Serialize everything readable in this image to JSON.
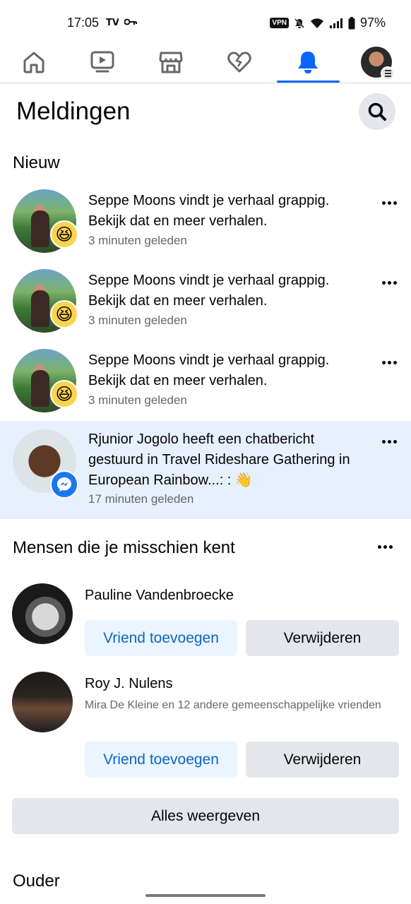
{
  "status_bar": {
    "time": "17:05",
    "vpn": "VPN",
    "battery": "97%"
  },
  "nav": {
    "items": [
      {
        "name": "home",
        "icon": "home-icon"
      },
      {
        "name": "video",
        "icon": "video-icon"
      },
      {
        "name": "marketplace",
        "icon": "store-icon"
      },
      {
        "name": "dating",
        "icon": "heart-icon"
      },
      {
        "name": "notifications",
        "icon": "bell-icon",
        "active": true
      },
      {
        "name": "menu",
        "icon": "profile-avatar"
      }
    ],
    "accent": "#0866ff"
  },
  "header": {
    "title": "Meldingen"
  },
  "sections": {
    "new": "Nieuw",
    "pymk": "Mensen die je misschien kent",
    "older": "Ouder"
  },
  "notifications": [
    {
      "actor": "Seppe Moons",
      "text_a": " vindt je verhaal grappig.",
      "text_b": "Bekijk dat en meer verhalen.",
      "time": "3 minuten geleden",
      "badge": "haha-emoji",
      "unread": false
    },
    {
      "actor": "Seppe Moons",
      "text_a": " vindt je verhaal grappig.",
      "text_b": "Bekijk dat en meer verhalen.",
      "time": "3 minuten geleden",
      "badge": "haha-emoji",
      "unread": false
    },
    {
      "actor": "Seppe Moons",
      "text_a": " vindt je verhaal grappig.",
      "text_b": "Bekijk dat en meer verhalen.",
      "time": "3 minuten geleden",
      "badge": "haha-emoji",
      "unread": false
    },
    {
      "actor": "Rjunior Jogolo",
      "text_a": " heeft een chatbericht gestuurd in ",
      "group": "Travel Rideshare Gathering",
      "text_in": " in ",
      "community": "European Rainbow...",
      "text_end": ": : 👋",
      "time": "17 minuten geleden",
      "badge": "messenger-icon",
      "unread": true
    }
  ],
  "people": [
    {
      "name": "Pauline Vandenbroecke",
      "mutual": "",
      "add_label": "Vriend toevoegen",
      "remove_label": "Verwijderen"
    },
    {
      "name": "Roy J. Nulens",
      "mutual": "Mira De Kleine en 12 andere gemeenschappelijke vrienden",
      "add_label": "Vriend toevoegen",
      "remove_label": "Verwijderen"
    }
  ],
  "see_all_label": "Alles weergeven",
  "colors": {
    "unread_bg": "#e7f0fd",
    "add_button_bg": "#ebf5ff",
    "add_button_text": "#0a66c2",
    "secondary_button_bg": "#e4e6eb",
    "meta_text": "#65676b"
  }
}
